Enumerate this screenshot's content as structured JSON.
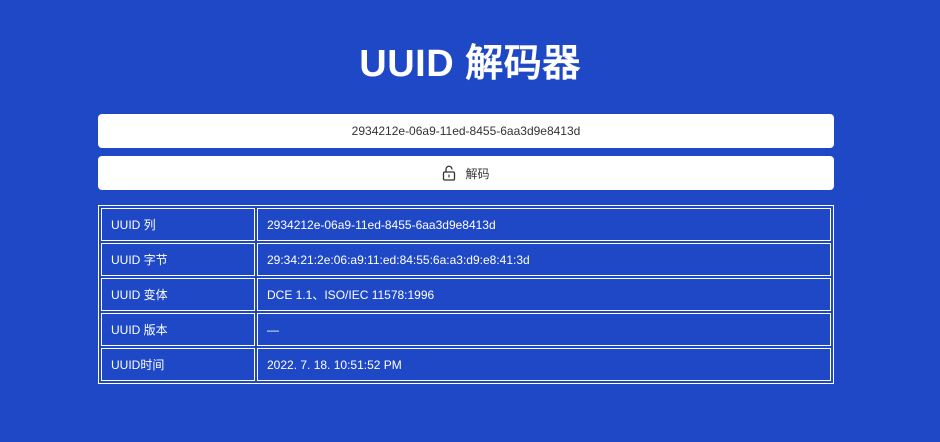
{
  "header": {
    "title": "UUID 解码器"
  },
  "uuid_input": {
    "value": "2934212e-06a9-11ed-8455-6aa3d9e8413d"
  },
  "decode_button": {
    "label": "解码",
    "icon": "unlock-icon"
  },
  "results": {
    "rows": [
      {
        "label": "UUID 列",
        "value": "2934212e-06a9-11ed-8455-6aa3d9e8413d"
      },
      {
        "label": "UUID 字节",
        "value": "29:34:21:2e:06:a9:11:ed:84:55:6a:a3:d9:e8:41:3d"
      },
      {
        "label": "UUID 变体",
        "value": "DCE 1.1、ISO/IEC 11578:1996"
      },
      {
        "label": "UUID 版本",
        "value": "—"
      },
      {
        "label": "UUID时间",
        "value": "2022. 7. 18. 10:51:52 PM"
      }
    ]
  },
  "colors": {
    "background": "#1f48c6",
    "surface": "#ffffff",
    "text_on_background": "#ffffff",
    "text_on_surface": "#333333"
  }
}
